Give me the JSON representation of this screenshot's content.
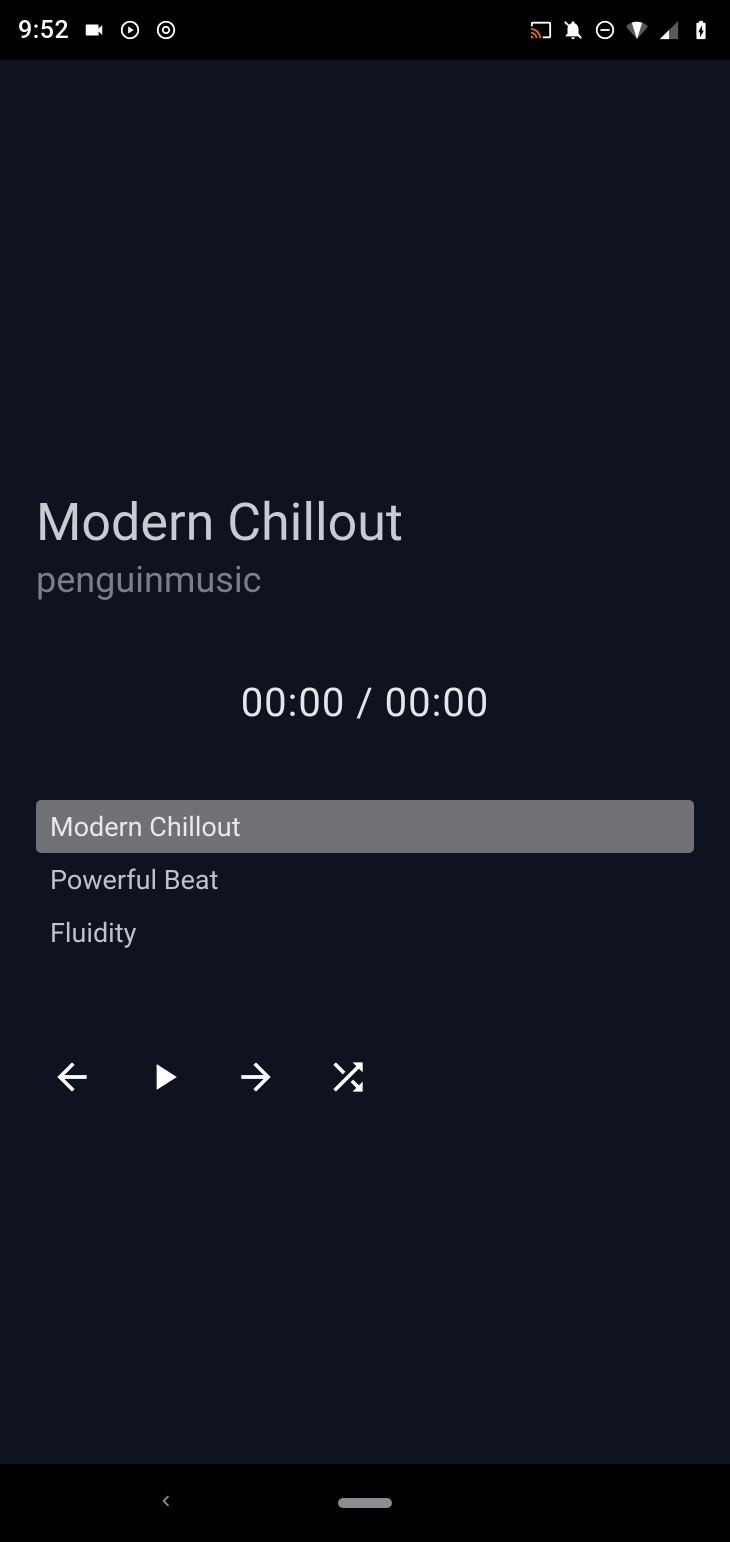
{
  "statusbar": {
    "time": "9:52"
  },
  "player": {
    "title": "Modern Chillout",
    "artist": "penguinmusic",
    "elapsed": "00:00",
    "duration": "00:00",
    "separator": " / "
  },
  "playlist": [
    {
      "label": "Modern Chillout",
      "selected": true
    },
    {
      "label": "Powerful Beat",
      "selected": false
    },
    {
      "label": "Fluidity",
      "selected": false
    }
  ],
  "controls": {
    "prev": "previous",
    "play": "play",
    "next": "next",
    "shuffle": "shuffle"
  }
}
